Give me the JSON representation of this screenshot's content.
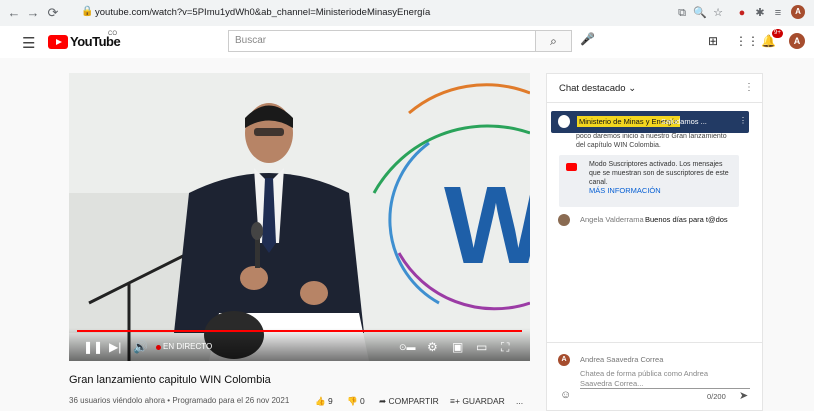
{
  "browser": {
    "url": "youtube.com/watch?v=5PImu1ydWh0&ab_channel=MinisteriodeMinasyEnergía",
    "profile_initial": "A"
  },
  "header": {
    "logo_text": "YouTube",
    "country_code": "CO",
    "search_placeholder": "Buscar",
    "notification_count": "9+",
    "avatar_initial": "A"
  },
  "player": {
    "live_label": "EN DIRECTO",
    "progress_fraction": 1.0,
    "overlay_letter": "W"
  },
  "video": {
    "title": "Gran lanzamiento capitulo WIN Colombia",
    "meta": "36 usuarios viéndolo ahora • Programado para el 26 nov 2021",
    "likes": "9",
    "dislikes": "0",
    "share_label": "COMPARTIR",
    "save_label": "GUARDAR",
    "more_label": "..."
  },
  "chat": {
    "header": "Chat destacado",
    "pinned": {
      "author": "Ministerio de Minas y Energía",
      "text": "Saludamos ...",
      "continuation": "poco daremos inicio a nuestro Gran lanzamiento del capítulo WIN Colombia."
    },
    "subscriber_mode": {
      "text": "Modo Suscriptores activado. Los mensajes que se muestran son de suscriptores de este canal.",
      "link": "MÁS INFORMACIÓN"
    },
    "messages": [
      {
        "author": "Angela Valderrama",
        "text": "Buenos días para t@dos"
      }
    ],
    "composer": {
      "user_name": "Andrea Saavedra Correa",
      "user_initial": "A",
      "placeholder": "Chatea de forma pública como Andrea Saavedra Correa...",
      "char_count": "0/200"
    }
  },
  "colors": {
    "accent_red": "#ff0000",
    "pinned_bg": "#223a64",
    "pinned_highlight": "#f3d61f",
    "link_blue": "#065fd4"
  }
}
